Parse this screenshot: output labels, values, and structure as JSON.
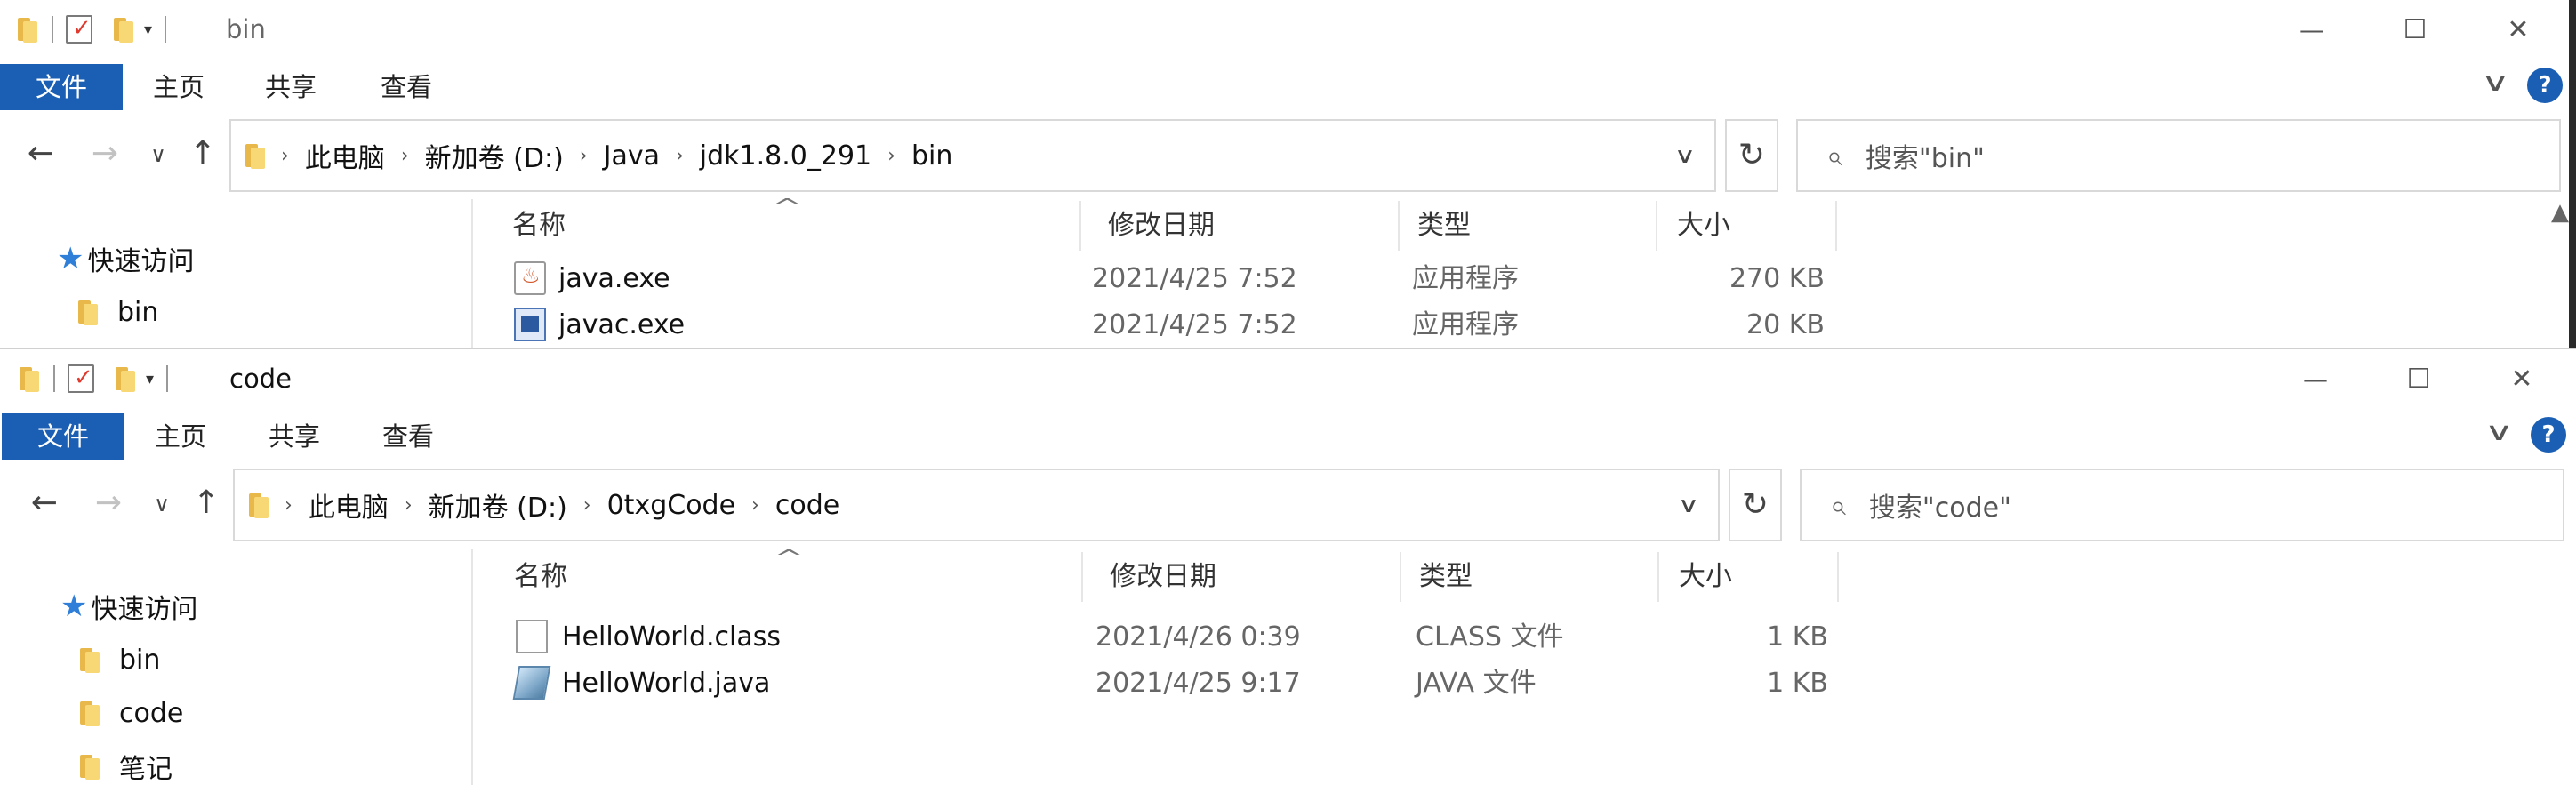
{
  "windows": [
    {
      "title": "bin",
      "ribbon": {
        "file_tab": "文件",
        "tabs": [
          "主页",
          "共享",
          "查看"
        ]
      },
      "nav": {
        "back": "←",
        "forward": "→",
        "recent": "∨",
        "up": "↑"
      },
      "address": {
        "crumbs": [
          "此电脑",
          "新加卷 (D:)",
          "Java",
          "jdk1.8.0_291",
          "bin"
        ],
        "separator": "›"
      },
      "search": {
        "placeholder": "搜索\"bin\""
      },
      "sidebar": {
        "quick_access": "快速访问",
        "items": [
          "bin"
        ]
      },
      "columns": {
        "name": "名称",
        "date": "修改日期",
        "type": "类型",
        "size": "大小"
      },
      "files": [
        {
          "name": "java.exe",
          "date": "2021/4/25 7:52",
          "type": "应用程序",
          "size": "270 KB",
          "icon": "java-exe-icon"
        },
        {
          "name": "javac.exe",
          "date": "2021/4/25 7:52",
          "type": "应用程序",
          "size": "20 KB",
          "icon": "javac-exe-icon"
        }
      ]
    },
    {
      "title": "code",
      "ribbon": {
        "file_tab": "文件",
        "tabs": [
          "主页",
          "共享",
          "查看"
        ]
      },
      "nav": {
        "back": "←",
        "forward": "→",
        "recent": "∨",
        "up": "↑"
      },
      "address": {
        "crumbs": [
          "此电脑",
          "新加卷 (D:)",
          "0txgCode",
          "code"
        ],
        "separator": "›"
      },
      "search": {
        "placeholder": "搜索\"code\""
      },
      "sidebar": {
        "quick_access": "快速访问",
        "items": [
          "bin",
          "code",
          "笔记"
        ]
      },
      "columns": {
        "name": "名称",
        "date": "修改日期",
        "type": "类型",
        "size": "大小"
      },
      "files": [
        {
          "name": "HelloWorld.class",
          "date": "2021/4/26 0:39",
          "type": "CLASS 文件",
          "size": "1 KB",
          "icon": "class-file-icon"
        },
        {
          "name": "HelloWorld.java",
          "date": "2021/4/25 9:17",
          "type": "JAVA 文件",
          "size": "1 KB",
          "icon": "java-file-icon"
        }
      ]
    }
  ],
  "glyphs": {
    "minimize": "—",
    "maximize": "☐",
    "close": "✕",
    "chevron": "∨",
    "refresh": "↻",
    "help": "?",
    "search": "⌕",
    "sort_up": "^",
    "scroll_up": "▲",
    "star": "★"
  },
  "colors": {
    "accent": "#1a5fb4",
    "star": "#2f7fd9",
    "folder": "#f8d775"
  }
}
